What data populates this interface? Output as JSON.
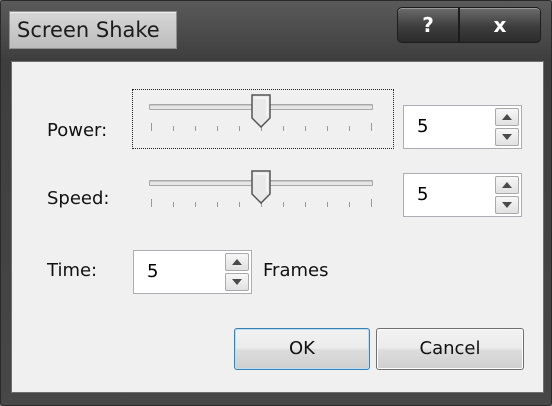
{
  "window": {
    "title": "Screen Shake",
    "help_button": "?",
    "close_button": "x"
  },
  "power": {
    "label": "Power:",
    "slider_value": 5,
    "slider_min": 0,
    "slider_max": 10,
    "spin_value": "5"
  },
  "speed": {
    "label": "Speed:",
    "slider_value": 5,
    "slider_min": 0,
    "slider_max": 10,
    "spin_value": "5"
  },
  "time": {
    "label": "Time:",
    "spin_value": "5",
    "unit": "Frames"
  },
  "buttons": {
    "ok": "OK",
    "cancel": "Cancel"
  }
}
